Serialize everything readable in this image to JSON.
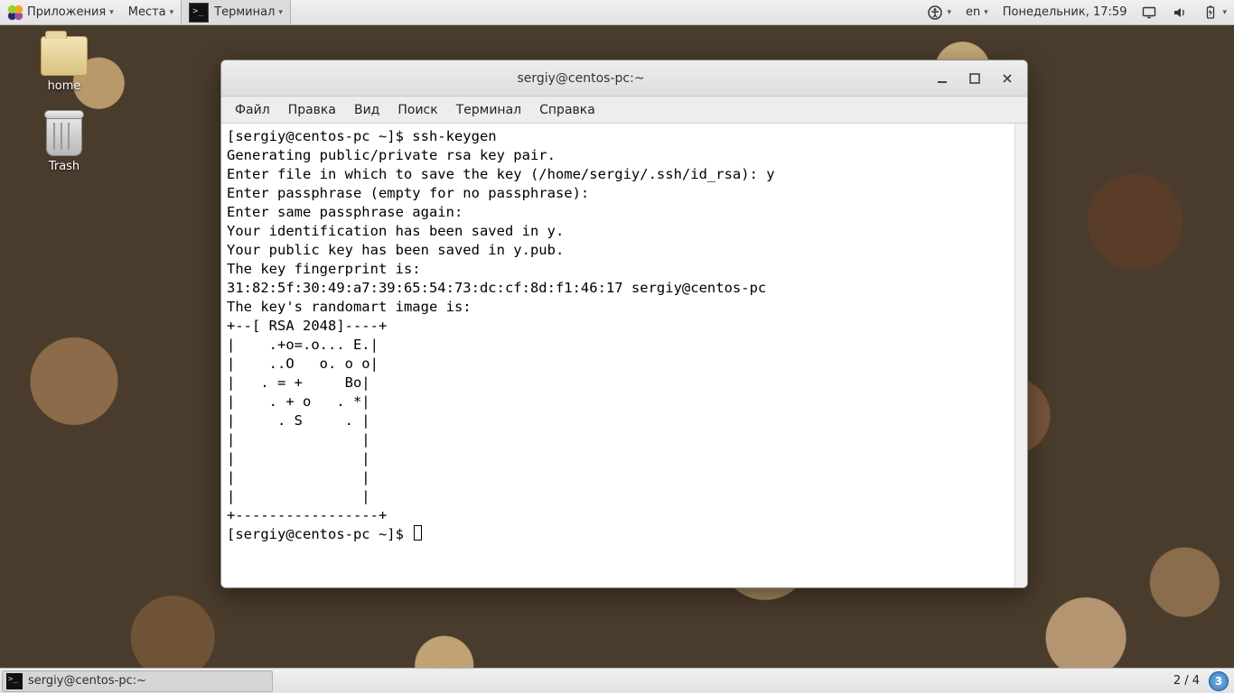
{
  "top_panel": {
    "applications": "Приложения",
    "places": "Места",
    "active_task": "Терминал",
    "accessibility_icon": "accessibility",
    "keyboard_layout": "en",
    "clock": "Понедельник, 17:59"
  },
  "desktop": {
    "home_label": "home",
    "trash_label": "Trash"
  },
  "terminal_window": {
    "title": "sergiy@centos-pc:~",
    "menu": {
      "file": "Файл",
      "edit": "Правка",
      "view": "Вид",
      "search": "Поиск",
      "terminal": "Терминал",
      "help": "Справка"
    },
    "lines": [
      "[sergiy@centos-pc ~]$ ssh-keygen",
      "Generating public/private rsa key pair.",
      "Enter file in which to save the key (/home/sergiy/.ssh/id_rsa): y",
      "Enter passphrase (empty for no passphrase): ",
      "Enter same passphrase again: ",
      "Your identification has been saved in y.",
      "Your public key has been saved in y.pub.",
      "The key fingerprint is:",
      "31:82:5f:30:49:a7:39:65:54:73:dc:cf:8d:f1:46:17 sergiy@centos-pc",
      "The key's randomart image is:",
      "+--[ RSA 2048]----+",
      "|    .+o=.o... E.|",
      "|    ..O   o. o o|",
      "|   . = +     Bo|",
      "|    . + o   . *|",
      "|     . S     . |",
      "|               |",
      "|               |",
      "|               |",
      "|               |",
      "+-----------------+",
      "[sergiy@centos-pc ~]$ "
    ]
  },
  "bottom_panel": {
    "task_label": "sergiy@centos-pc:~",
    "workspace_text": "2 / 4",
    "workspace_badge": "3"
  }
}
